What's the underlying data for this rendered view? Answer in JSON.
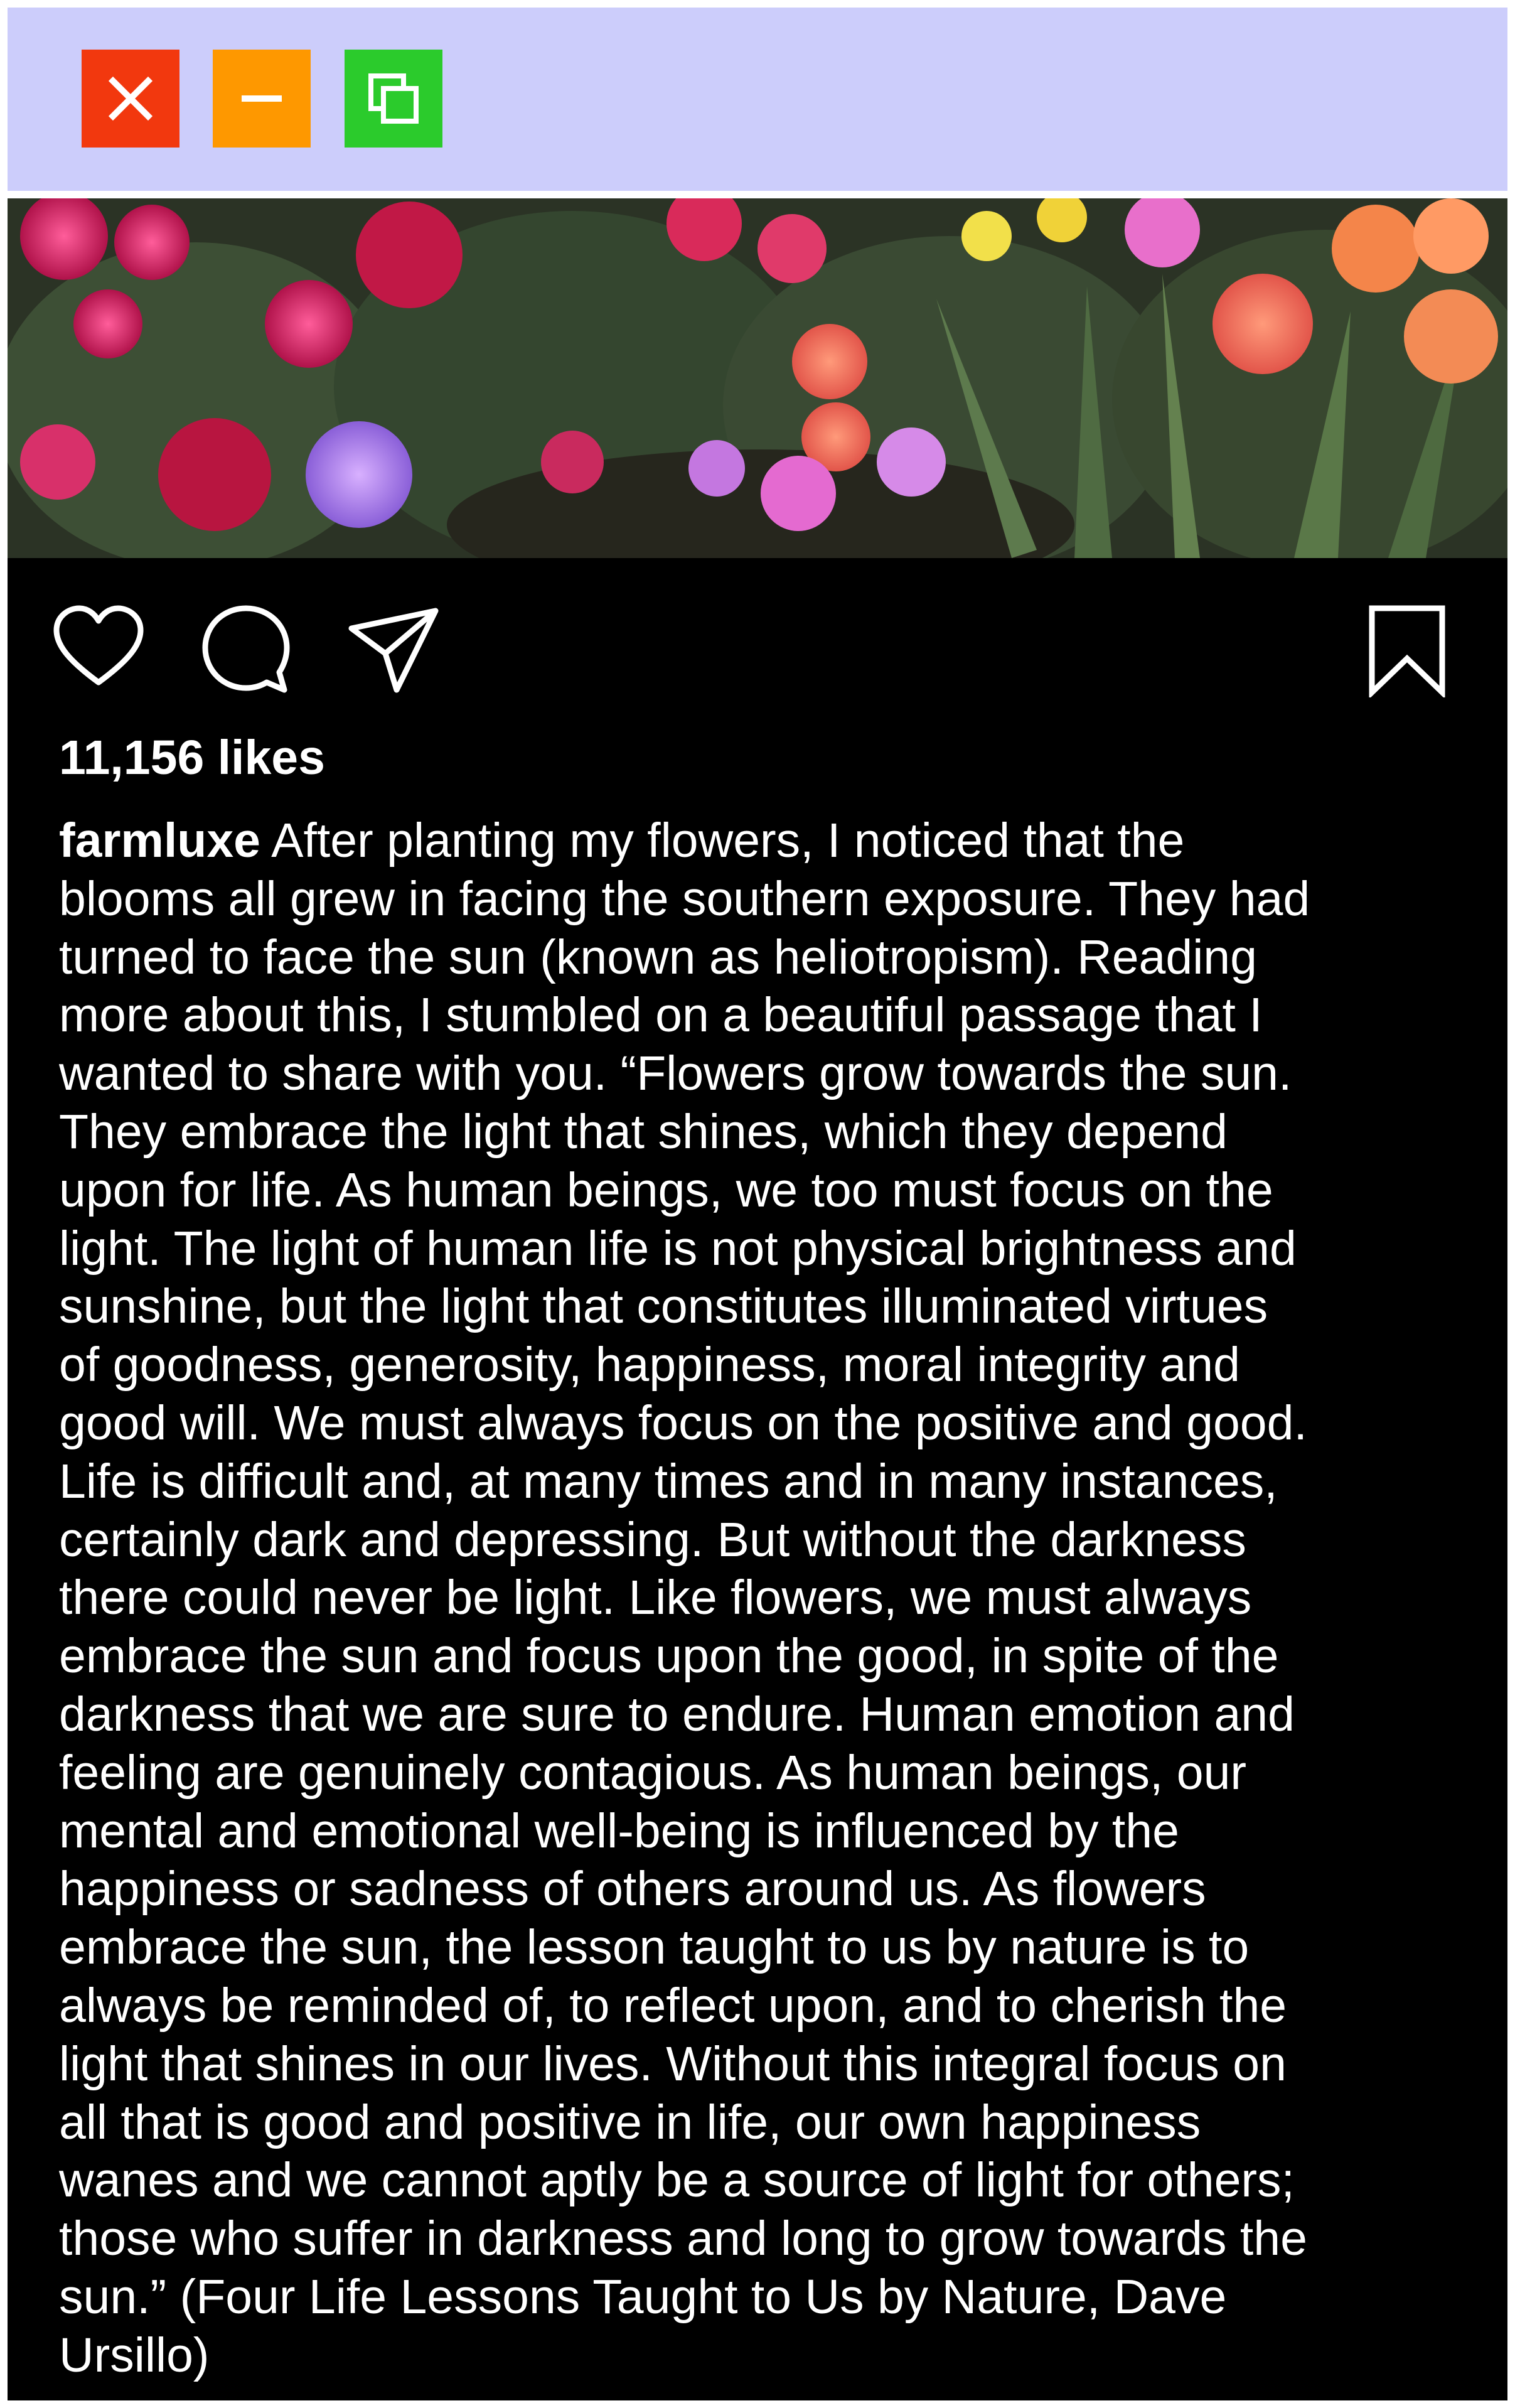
{
  "window": {
    "buttons": [
      {
        "name": "close",
        "icon": "close-icon",
        "color": "#f2380e"
      },
      {
        "name": "minimize",
        "icon": "minimize-icon",
        "color": "#fe9800"
      },
      {
        "name": "maximize",
        "icon": "maximize-icon",
        "color": "#2bcb2c"
      }
    ],
    "titlebar_color": "#cccdfb"
  },
  "post": {
    "image": "flower-garden-photo",
    "actions": [
      "heart-icon",
      "comment-icon",
      "share-icon",
      "bookmark-icon"
    ],
    "likes": "11,156 likes",
    "username": "farmluxe",
    "caption_lines": [
      " After planting my flowers, I noticed that the",
      "blooms all grew in facing the southern exposure. They had",
      "turned to face the sun (known as heliotropism). Reading",
      "more about this, I stumbled on a beautiful passage that I",
      "wanted to share with you. “Flowers grow towards the sun.",
      "They embrace the light that shines, which they depend",
      "upon for life. As human beings, we too must focus on the",
      "light. The light of human life is not physical brightness and",
      "sunshine, but the light that constitutes illuminated virtues",
      "of goodness, generosity, happiness, moral integrity and",
      "good will. We must always focus on the positive and good.",
      "Life is difficult and, at many times and in many instances,",
      "certainly dark and depressing. But without the darkness",
      "there could never be light. Like flowers, we must always",
      "embrace the sun and focus upon the good, in spite of the",
      "darkness that we are sure to endure. Human emotion and",
      "feeling are genuinely contagious. As human beings, our",
      "mental and emotional well-being is influenced by the",
      "happiness or sadness of others around us. As flowers",
      "embrace the sun, the lesson taught to us by nature is to",
      "always be reminded of, to reflect upon, and to cherish the",
      "light that shines in our lives. Without this integral focus on",
      "all that is good and positive in life, our own happiness",
      "wanes and we cannot aptly be a source of light for others;",
      "those who suffer in darkness and long to grow towards the",
      "sun.” (Four Life Lessons Taught to Us by Nature, Dave",
      "Ursillo)"
    ]
  }
}
